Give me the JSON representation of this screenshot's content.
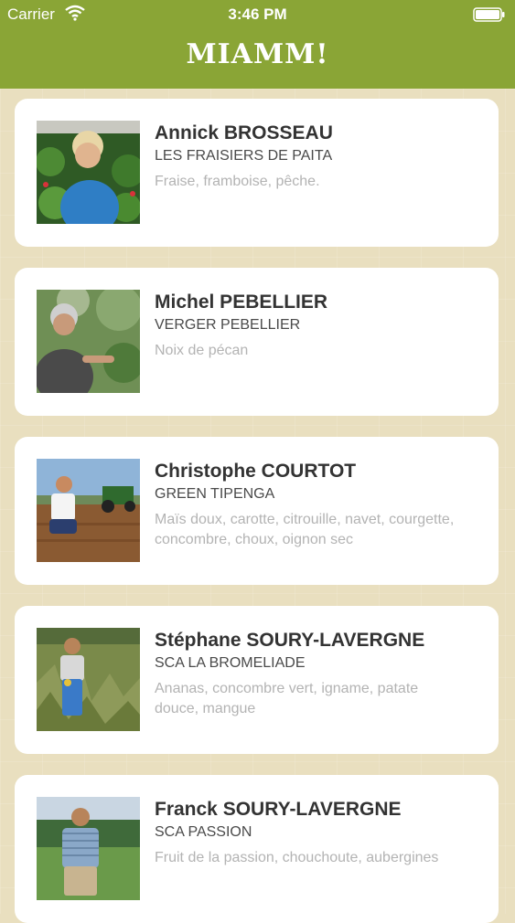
{
  "status_bar": {
    "carrier": "Carrier",
    "time": "3:46 PM"
  },
  "header": {
    "title": "MIAMM!"
  },
  "producers": [
    {
      "name": "Annick BROSSEAU",
      "farm": "LES FRAISIERS DE PAITA",
      "products": "Fraise, framboise, pêche."
    },
    {
      "name": "Michel PEBELLIER",
      "farm": "VERGER PEBELLIER",
      "products": "Noix de pécan"
    },
    {
      "name": "Christophe COURTOT",
      "farm": "GREEN TIPENGA",
      "products": "Maïs doux, carotte, citrouille, navet, courgette, concombre, choux, oignon sec"
    },
    {
      "name": "Stéphane SOURY-LAVERGNE",
      "farm": "SCA LA BROMELIADE",
      "products": "Ananas, concombre vert, igname, patate douce, mangue"
    },
    {
      "name": "Franck SOURY-LAVERGNE",
      "farm": "SCA PASSION",
      "products": "Fruit de la passion, chouchoute, aubergines"
    }
  ]
}
